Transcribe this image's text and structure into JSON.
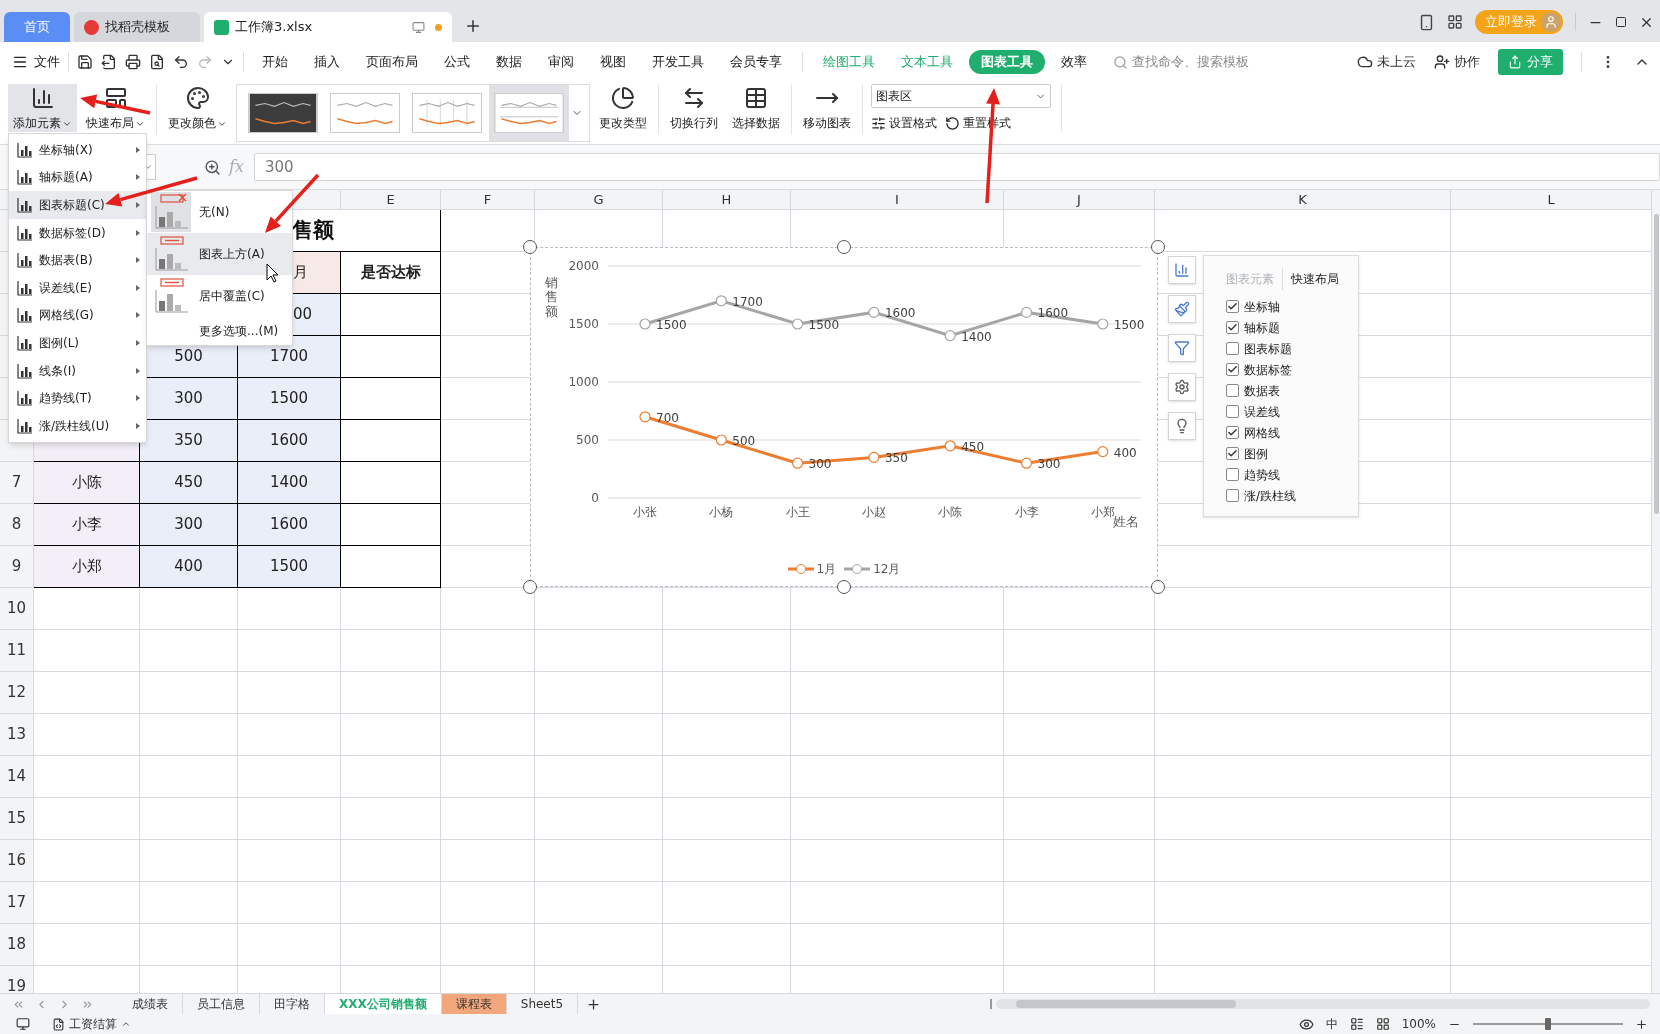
{
  "title_bar": {
    "tabs": [
      {
        "label": "首页",
        "kind": "home",
        "selected": false
      },
      {
        "label": "找稻壳模板",
        "kind": "template",
        "selected": false
      },
      {
        "label": "工作簿3.xlsx",
        "kind": "sheet",
        "selected": true
      }
    ],
    "login": "立即登录"
  },
  "menu_bar": {
    "file": "文件",
    "tabs": [
      {
        "label": "开始",
        "kind": "normal",
        "selected": false
      },
      {
        "label": "插入",
        "kind": "normal",
        "selected": false
      },
      {
        "label": "页面布局",
        "kind": "normal",
        "selected": false
      },
      {
        "label": "公式",
        "kind": "normal",
        "selected": false
      },
      {
        "label": "数据",
        "kind": "normal",
        "selected": false
      },
      {
        "label": "审阅",
        "kind": "normal",
        "selected": false
      },
      {
        "label": "视图",
        "kind": "normal",
        "selected": false
      },
      {
        "label": "开发工具",
        "kind": "normal",
        "selected": false
      },
      {
        "label": "会员专享",
        "kind": "normal",
        "selected": false
      },
      {
        "label": "绘图工具",
        "kind": "context",
        "selected": false
      },
      {
        "label": "文本工具",
        "kind": "context",
        "selected": false
      },
      {
        "label": "图表工具",
        "kind": "context",
        "selected": true
      },
      {
        "label": "效率",
        "kind": "normal",
        "selected": false
      }
    ],
    "search": {
      "placeholder": "查找命令、搜索模板"
    },
    "cloud": "未上云",
    "collab": "协作",
    "share": "分享"
  },
  "ribbon": {
    "add_element": {
      "label": "添加元素",
      "selected": true
    },
    "quick_layout": "快速布局",
    "change_color": "更改颜色",
    "chart_styles": [
      {
        "kind": "dark",
        "selected": false
      },
      {
        "kind": "light",
        "selected": false
      },
      {
        "kind": "grid",
        "selected": false
      },
      {
        "kind": "banded",
        "selected": true
      }
    ],
    "change_type": "更改类型",
    "switch_rows": "切换行列",
    "select_data": "选择数据",
    "move_chart": "移动图表",
    "chart_area": {
      "value": "图表区"
    },
    "format": "设置格式",
    "reset_style": "重置样式"
  },
  "formula_bar": {
    "fx": "fx",
    "value": "300"
  },
  "columns": [
    "E",
    "F",
    "G",
    "H",
    "I",
    "J",
    "K",
    "L"
  ],
  "rows": [
    {
      "title": "售额"
    },
    {
      "column_3": "月",
      "column_4": "是否达标"
    },
    {
      "column_3": "00"
    },
    {
      "column_2": "500",
      "column_3": "1700"
    },
    {
      "column_2": "300",
      "column_3": "1500"
    },
    {
      "column_2": "350",
      "column_3": "1600"
    },
    {
      "number": "7",
      "column_1": "小陈",
      "column_2": "450",
      "column_3": "1400"
    },
    {
      "number": "8",
      "column_1": "小李",
      "column_2": "300",
      "column_3": "1600"
    },
    {
      "number": "9",
      "column_1": "小郑",
      "column_2": "400",
      "column_3": "1500"
    },
    {
      "number": "10"
    },
    {
      "number": "11"
    },
    {
      "number": "12"
    },
    {
      "number": "13"
    },
    {
      "number": "14"
    },
    {
      "number": "15"
    },
    {
      "number": "16"
    },
    {
      "number": "17"
    },
    {
      "number": "18"
    },
    {
      "number": "19"
    }
  ],
  "chart": {
    "chart_data": {
      "type": "line",
      "categories": [
        "小张",
        "小杨",
        "小王",
        "小赵",
        "小陈",
        "小李",
        "小郑"
      ],
      "series": [
        {
          "name": "1月",
          "color": "#ed7d31",
          "marker": "circle",
          "values": [
            700,
            500,
            300,
            350,
            450,
            300,
            400
          ]
        },
        {
          "name": "12月",
          "color": "#a5a5a5",
          "marker": "circle",
          "values": [
            1500,
            1700,
            1500,
            1600,
            1400,
            1600,
            1500
          ]
        }
      ],
      "ylim": [
        0,
        2000
      ],
      "yticks": [
        0,
        500,
        1000,
        1500,
        2000
      ],
      "ylabel": "销售额",
      "xlabel": "姓名",
      "data_labels": true,
      "grid": true,
      "legend": "bottom"
    }
  },
  "chart_panel": {
    "tabs": [
      {
        "label": "图表元素",
        "selected": true
      },
      {
        "label": "快速布局",
        "selected": false
      }
    ],
    "items": [
      {
        "label": "坐标轴",
        "checked": true
      },
      {
        "label": "轴标题",
        "checked": true
      },
      {
        "label": "图表标题",
        "checked": false
      },
      {
        "label": "数据标签",
        "checked": true
      },
      {
        "label": "数据表",
        "checked": false
      },
      {
        "label": "误差线",
        "checked": false
      },
      {
        "label": "网格线",
        "checked": true
      },
      {
        "label": "图例",
        "checked": true
      },
      {
        "label": "趋势线",
        "checked": false
      },
      {
        "label": "涨/跌柱线",
        "checked": false
      }
    ]
  },
  "add_element_menu": {
    "items": [
      {
        "label": "坐标轴(X)",
        "selected": false
      },
      {
        "label": "轴标题(A)",
        "selected": false
      },
      {
        "label": "图表标题(C)",
        "selected": true
      },
      {
        "label": "数据标签(D)",
        "selected": false
      },
      {
        "label": "数据表(B)",
        "selected": false
      },
      {
        "label": "误差线(E)",
        "selected": false
      },
      {
        "label": "网格线(G)",
        "selected": false
      },
      {
        "label": "图例(L)",
        "selected": false
      },
      {
        "label": "线条(I)",
        "selected": false
      },
      {
        "label": "趋势线(T)",
        "selected": false
      },
      {
        "label": "涨/跌柱线(U)",
        "selected": false
      }
    ]
  },
  "chart_title_submenu": {
    "items": [
      {
        "label": "无(N)",
        "kind": "none",
        "current": true,
        "selected": false
      },
      {
        "label": "图表上方(A)",
        "kind": "above",
        "current": false,
        "selected": true
      },
      {
        "label": "居中覆盖(C)",
        "kind": "overlay",
        "current": false,
        "selected": false
      },
      {
        "label": "更多选项...(M)",
        "kind": "more",
        "selected": false
      }
    ]
  },
  "sheet_tabs": [
    {
      "label": "成绩表",
      "selected": false
    },
    {
      "label": "员工信息",
      "selected": false
    },
    {
      "label": "田字格",
      "selected": false
    },
    {
      "label": "XXX公司销售额",
      "selected": true
    },
    {
      "label": "课程表",
      "selected": false,
      "color": "#f4a77c"
    },
    {
      "label": "Sheet5",
      "selected": false
    }
  ],
  "status_bar": {
    "macro": "工资结算",
    "input_mode": "中",
    "zoom": "100%",
    "zoom_slider": {
      "level": 0.5
    }
  }
}
